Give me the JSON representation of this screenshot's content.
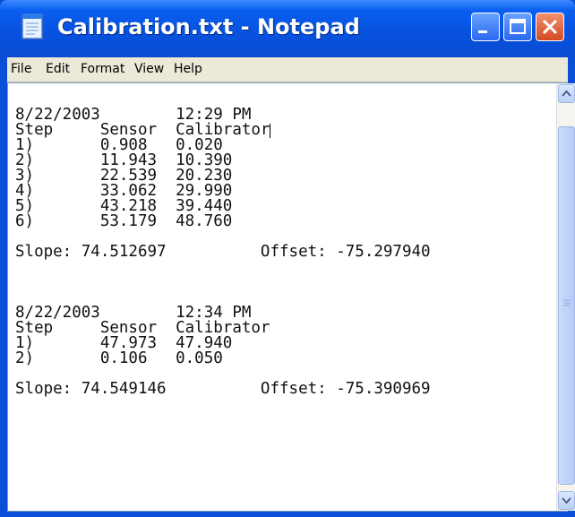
{
  "window": {
    "title": "Calibration.txt - Notepad"
  },
  "menu": {
    "items": [
      "File",
      "Edit",
      "Format",
      "View",
      "Help"
    ]
  },
  "document": {
    "lines": [
      "",
      "8/22/2003        12:29 PM",
      "Step     Sensor  Calibrator",
      "1)       0.908   0.020",
      "2)       11.943  10.390",
      "3)       22.539  20.230",
      "4)       33.062  29.990",
      "5)       43.218  39.440",
      "6)       53.179  48.760",
      "",
      "Slope: 74.512697          Offset: -75.297940",
      "",
      "",
      "",
      "8/22/2003        12:34 PM",
      "Step     Sensor  Calibrator",
      "1)       47.973  47.940",
      "2)       0.106   0.050",
      "",
      "Slope: 74.549146          Offset: -75.390969"
    ]
  },
  "icons": {
    "app": "notepad-icon",
    "minimize": "minimize-icon",
    "maximize": "maximize-icon",
    "close": "close-icon",
    "scroll_up": "chevron-up-icon",
    "scroll_down": "chevron-down-icon"
  },
  "colors": {
    "titlebar": "#0753e0",
    "close_button": "#d44a22",
    "menubar": "#ece9d8"
  }
}
